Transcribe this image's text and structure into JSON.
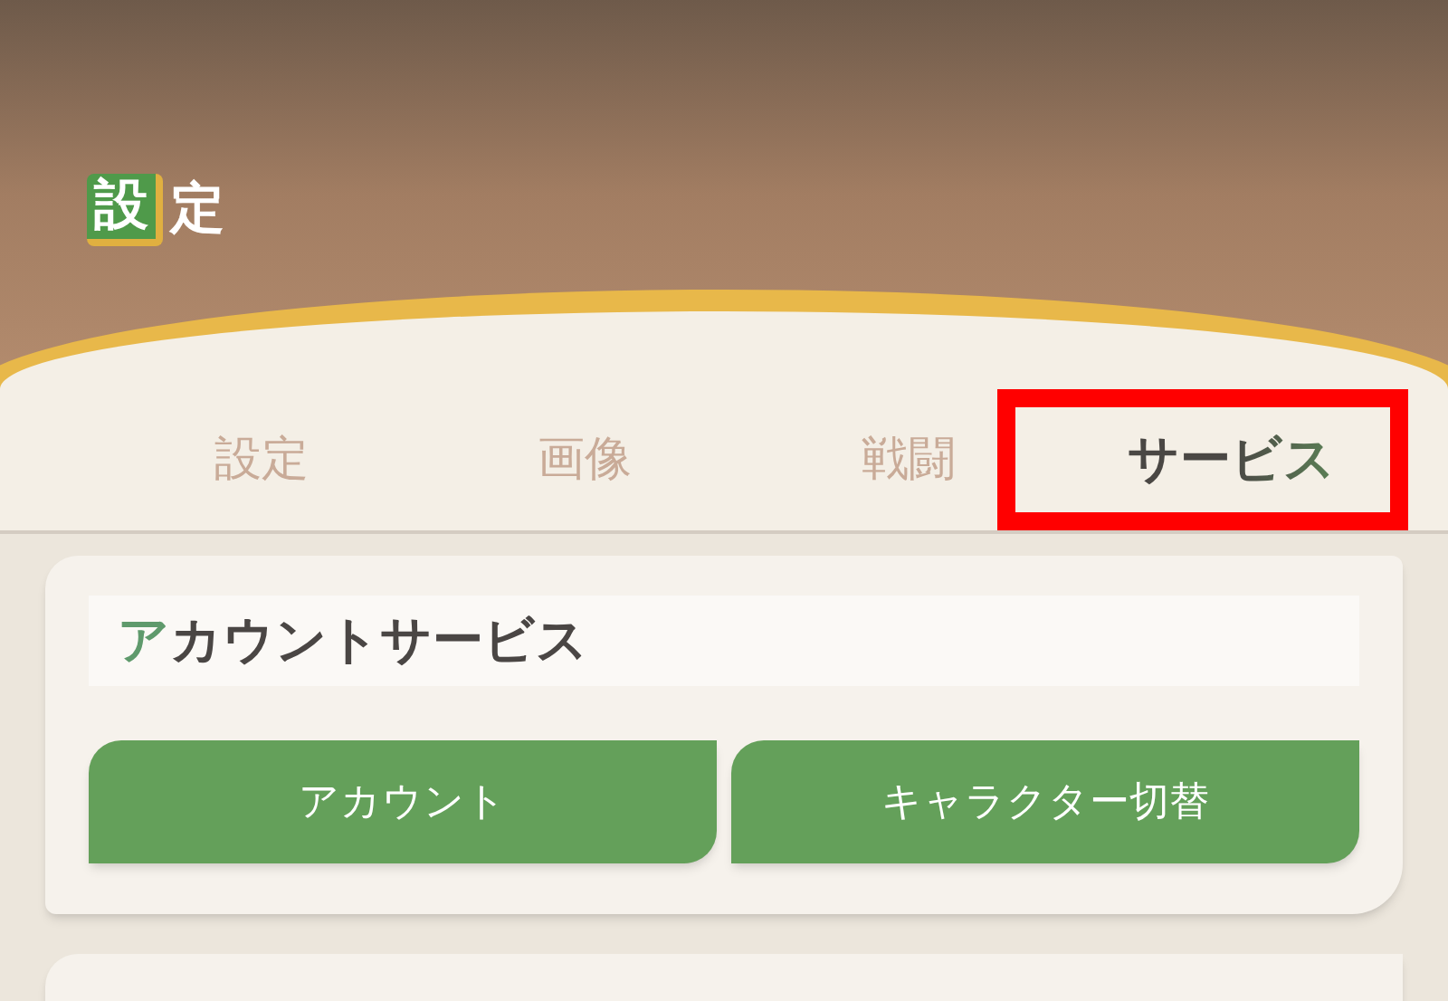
{
  "header": {
    "title_badge": "設",
    "title_rest": "定"
  },
  "tabs": [
    {
      "label": "設定",
      "selected": false,
      "highlighted": false
    },
    {
      "label": "画像",
      "selected": false,
      "highlighted": false
    },
    {
      "label": "戦闘",
      "selected": false,
      "highlighted": false
    },
    {
      "label": "サービス",
      "selected": true,
      "highlighted": true
    }
  ],
  "sections": [
    {
      "heading_accent": "ア",
      "heading_rest": "カウントサービス",
      "buttons": [
        "アカウント",
        "キャラクター切替"
      ]
    }
  ]
}
